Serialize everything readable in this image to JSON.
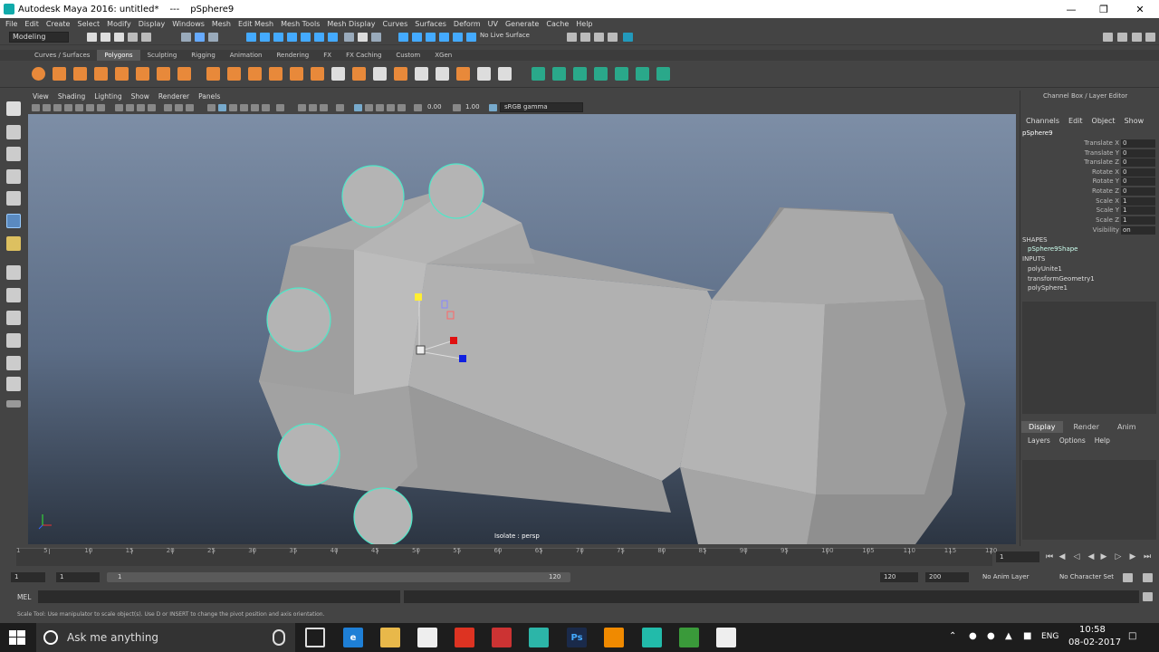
{
  "window": {
    "title": "Autodesk Maya 2016: untitled*",
    "separator": "---",
    "object": "pSphere9"
  },
  "menus": [
    "File",
    "Edit",
    "Create",
    "Select",
    "Modify",
    "Display",
    "Windows",
    "Mesh",
    "Edit Mesh",
    "Mesh Tools",
    "Mesh Display",
    "Curves",
    "Surfaces",
    "Deform",
    "UV",
    "Generate",
    "Cache",
    "Help"
  ],
  "status": {
    "mode": "Modeling",
    "live_surface": "No Live Surface"
  },
  "shelf_tabs": [
    "Curves / Surfaces",
    "Polygons",
    "Sculpting",
    "Rigging",
    "Animation",
    "Rendering",
    "FX",
    "FX Caching",
    "Custom",
    "XGen"
  ],
  "panel_menu": [
    "View",
    "Shading",
    "Lighting",
    "Show",
    "Renderer",
    "Panels"
  ],
  "panel_toolbar": {
    "exposure": "0.00",
    "gamma": "1.00",
    "color_space": "sRGB gamma"
  },
  "viewport": {
    "label": "Isolate : persp",
    "background_top": "#7d8ea6",
    "background_bottom": "#2c3542"
  },
  "channel_box": {
    "title": "Channel Box / Layer Editor",
    "menu": [
      "Channels",
      "Edit",
      "Object",
      "Show"
    ],
    "object": "pSphere9",
    "attributes": [
      {
        "name": "Translate X",
        "value": "0"
      },
      {
        "name": "Translate Y",
        "value": "0"
      },
      {
        "name": "Translate Z",
        "value": "0"
      },
      {
        "name": "Rotate X",
        "value": "0"
      },
      {
        "name": "Rotate Y",
        "value": "0"
      },
      {
        "name": "Rotate Z",
        "value": "0"
      },
      {
        "name": "Scale X",
        "value": "1"
      },
      {
        "name": "Scale Y",
        "value": "1"
      },
      {
        "name": "Scale Z",
        "value": "1"
      },
      {
        "name": "Visibility",
        "value": "on"
      }
    ],
    "shapes_heading": "SHAPES",
    "shape": "pSphere9Shape",
    "inputs_heading": "INPUTS",
    "inputs": [
      "polyUnite1",
      "transformGeometry1",
      "polySphere1"
    ]
  },
  "layer_editor": {
    "tabs": [
      "Display",
      "Render",
      "Anim"
    ],
    "menu": [
      "Layers",
      "Options",
      "Help"
    ]
  },
  "timeline": {
    "ticks": [
      "5",
      "10",
      "15",
      "20",
      "25",
      "30",
      "35",
      "40",
      "45",
      "50",
      "55",
      "60",
      "65",
      "70",
      "75",
      "80",
      "85",
      "90",
      "95",
      "100",
      "105",
      "110",
      "115",
      "120"
    ],
    "first_tick": "1",
    "current_frame": "1"
  },
  "range": {
    "start": "1",
    "playback_start": "1",
    "slider_start": "1",
    "slider_end": "120",
    "playback_end": "120",
    "end": "200",
    "anim_layer": "No Anim Layer",
    "character_set": "No Character Set"
  },
  "mel": {
    "label": "MEL"
  },
  "help_line": "Scale Tool: Use manipulator to scale object(s). Use D or INSERT to change the pivot position and axis orientation.",
  "taskbar": {
    "search_placeholder": "Ask me anything",
    "ps_label": "Ps",
    "language": "ENG",
    "time": "10:58",
    "date": "08-02-2017"
  }
}
